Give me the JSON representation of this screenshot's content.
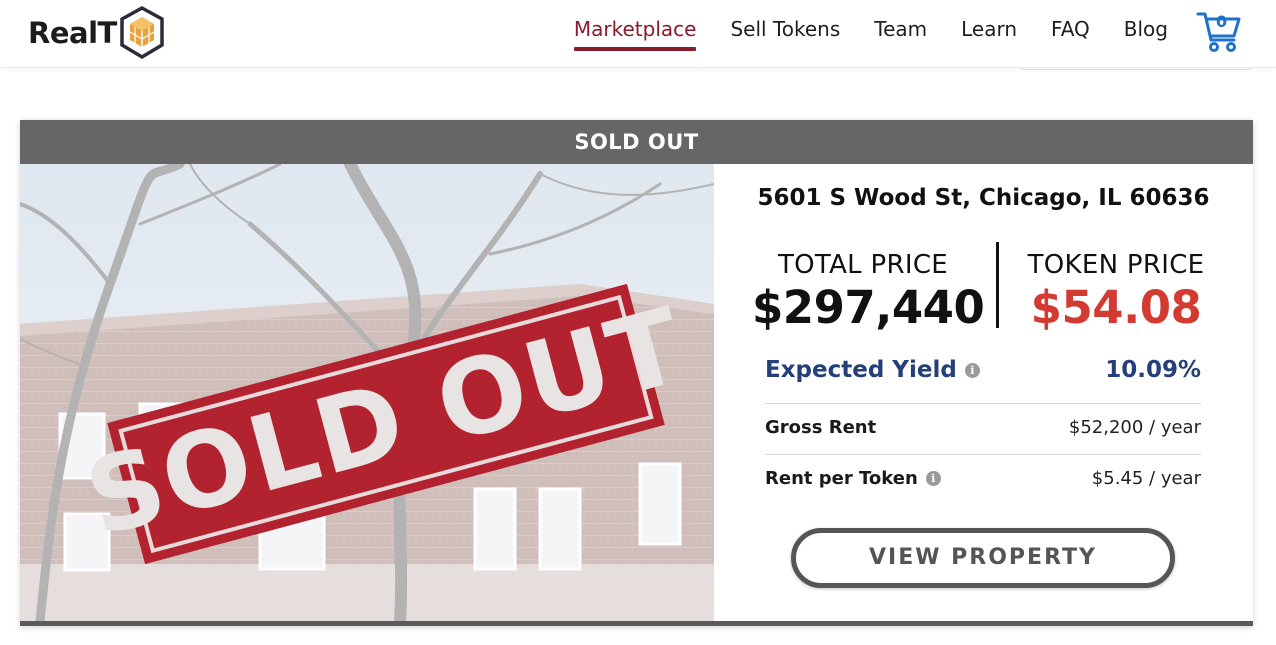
{
  "header": {
    "logo_text": "RealT",
    "nav": [
      {
        "label": "Marketplace",
        "active": true
      },
      {
        "label": "Sell Tokens",
        "active": false
      },
      {
        "label": "Team",
        "active": false
      },
      {
        "label": "Learn",
        "active": false
      },
      {
        "label": "FAQ",
        "active": false
      },
      {
        "label": "Blog",
        "active": false
      }
    ],
    "cart_count": "0",
    "cart_icon": "cart-icon"
  },
  "card": {
    "banner": "SOLD OUT",
    "stamp_text": "SOLD OUT",
    "address": "5601 S Wood St, Chicago, IL 60636",
    "total_price_label": "TOTAL PRICE",
    "total_price_value": "$297,440",
    "token_price_label": "TOKEN PRICE",
    "token_price_value": "$54.08",
    "expected_yield_label": "Expected Yield",
    "expected_yield_value": "10.09%",
    "gross_rent_label": "Gross Rent",
    "gross_rent_value": "$52,200 / year",
    "rent_per_token_label": "Rent per Token",
    "rent_per_token_value": "$5.45 / year",
    "info_icon_glyph": "i",
    "view_button": "VIEW PROPERTY"
  },
  "colors": {
    "active_nav": "#8b1a2b",
    "token_price": "#d23a32",
    "yield": "#243f7a",
    "banner": "#666666",
    "cart": "#1e73c8"
  }
}
